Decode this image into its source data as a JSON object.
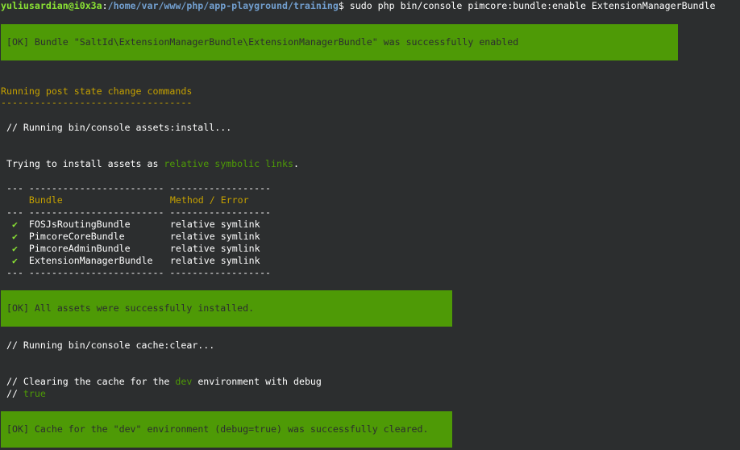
{
  "prompt": {
    "user_host": "yuliusardian@i0x3a",
    "separator": ":",
    "path": "/home/var/www/php/app-playground/training",
    "dollar": "$",
    "command": " sudo php bin/console pimcore:bundle:enable ExtensionManagerBundle"
  },
  "ok_enabled": "[OK] Bundle \"SaltId\\ExtensionManagerBundle\\ExtensionManagerBundle\" was successfully enabled",
  "post_state_title": "Running post state change commands",
  "post_state_underline": "----------------------------------",
  "running_assets": " // Running bin/console assets:install...",
  "trying": {
    "prefix": " Trying to install assets as ",
    "highlight": "relative symbolic links",
    "suffix": "."
  },
  "table": {
    "separator": " --- ------------------------ ------------------",
    "headers": [
      "Bundle",
      "Method / Error"
    ],
    "check_glyph": "✔",
    "rows": [
      {
        "bundle": "FOSJsRoutingBundle",
        "method": "relative symlink"
      },
      {
        "bundle": "PimcoreCoreBundle",
        "method": "relative symlink"
      },
      {
        "bundle": "PimcoreAdminBundle",
        "method": "relative symlink"
      },
      {
        "bundle": "ExtensionManagerBundle",
        "method": "relative symlink"
      }
    ]
  },
  "ok_assets": "[OK] All assets were successfully installed.",
  "running_cache": " // Running bin/console cache:clear...",
  "clearing": {
    "prefix": " // Clearing the cache for the ",
    "env": "dev",
    "suffix": " environment with debug",
    "line2_prefix": " // ",
    "line2_value": "true"
  },
  "ok_cache": "[OK] Cache for the \"dev\" environment (debug=true) was successfully cleared.",
  "colors": {
    "background": "#2c2e2f",
    "banner": "#4e9a06",
    "user": "#8ae234",
    "path": "#729fcf",
    "yellow": "#c4a000"
  }
}
